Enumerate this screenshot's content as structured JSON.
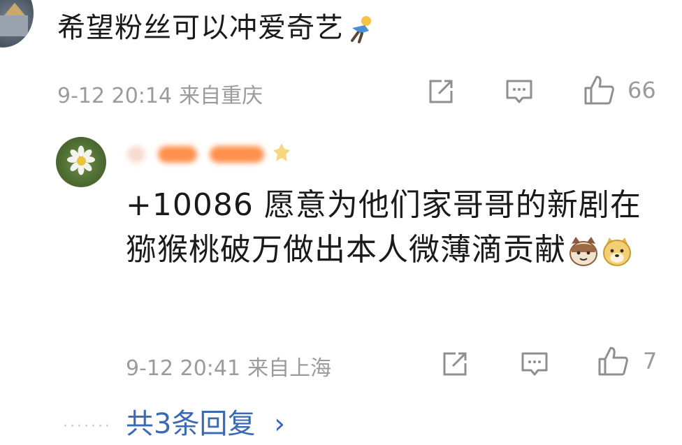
{
  "top_comment": {
    "text": "希望粉丝可以冲爱奇艺",
    "emoji": "running-person-emoji",
    "date": "9-12 20:14",
    "location": "来自重庆",
    "like_count": "66"
  },
  "reply": {
    "text": "+10086 愿意为他们家哥哥的新剧在猕猴桃破万做出本人微薄滴贡献",
    "emojis": [
      "cat-face-emoji",
      "doge-face-emoji"
    ],
    "date": "9-12 20:41",
    "location": "来自上海",
    "like_count": "7"
  },
  "more_replies": {
    "label": "共3条回复",
    "chevron": "›"
  },
  "icons": {
    "share": "share-icon",
    "comment": "comment-icon",
    "like": "thumbs-up-icon"
  }
}
